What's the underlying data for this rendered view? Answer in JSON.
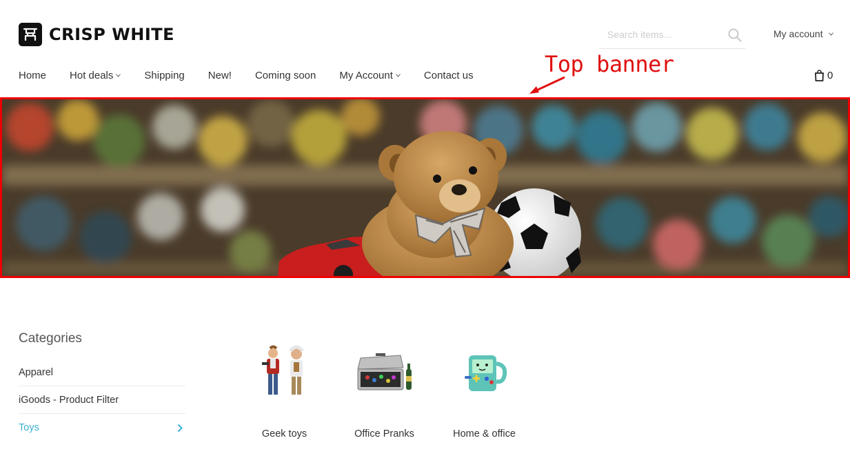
{
  "brand": {
    "name": "CRISP WHITE",
    "logo_icon": "store-logo-icon"
  },
  "search": {
    "placeholder": "Search items...",
    "icon": "search-icon"
  },
  "account": {
    "label": "My account"
  },
  "nav": {
    "items": [
      {
        "label": "Home",
        "has_dropdown": false
      },
      {
        "label": "Hot deals",
        "has_dropdown": true
      },
      {
        "label": "Shipping",
        "has_dropdown": false
      },
      {
        "label": "New!",
        "has_dropdown": false
      },
      {
        "label": "Coming soon",
        "has_dropdown": false
      },
      {
        "label": "My Account",
        "has_dropdown": true
      },
      {
        "label": "Contact us",
        "has_dropdown": false
      }
    ]
  },
  "cart": {
    "count": "0",
    "icon": "shopping-bag-icon"
  },
  "annotation": {
    "text": "Top banner",
    "color": "#e01010"
  },
  "banner": {
    "border_color": "#ee0000"
  },
  "categories": {
    "title": "Categories",
    "items": [
      {
        "label": "Apparel",
        "active": false
      },
      {
        "label": "iGoods - Product Filter",
        "active": false
      },
      {
        "label": "Toys",
        "active": true
      }
    ],
    "active_color": "#3bb0d6"
  },
  "subcategories": [
    {
      "label": "Geek toys"
    },
    {
      "label": "Office Pranks"
    },
    {
      "label": "Home & office"
    }
  ]
}
